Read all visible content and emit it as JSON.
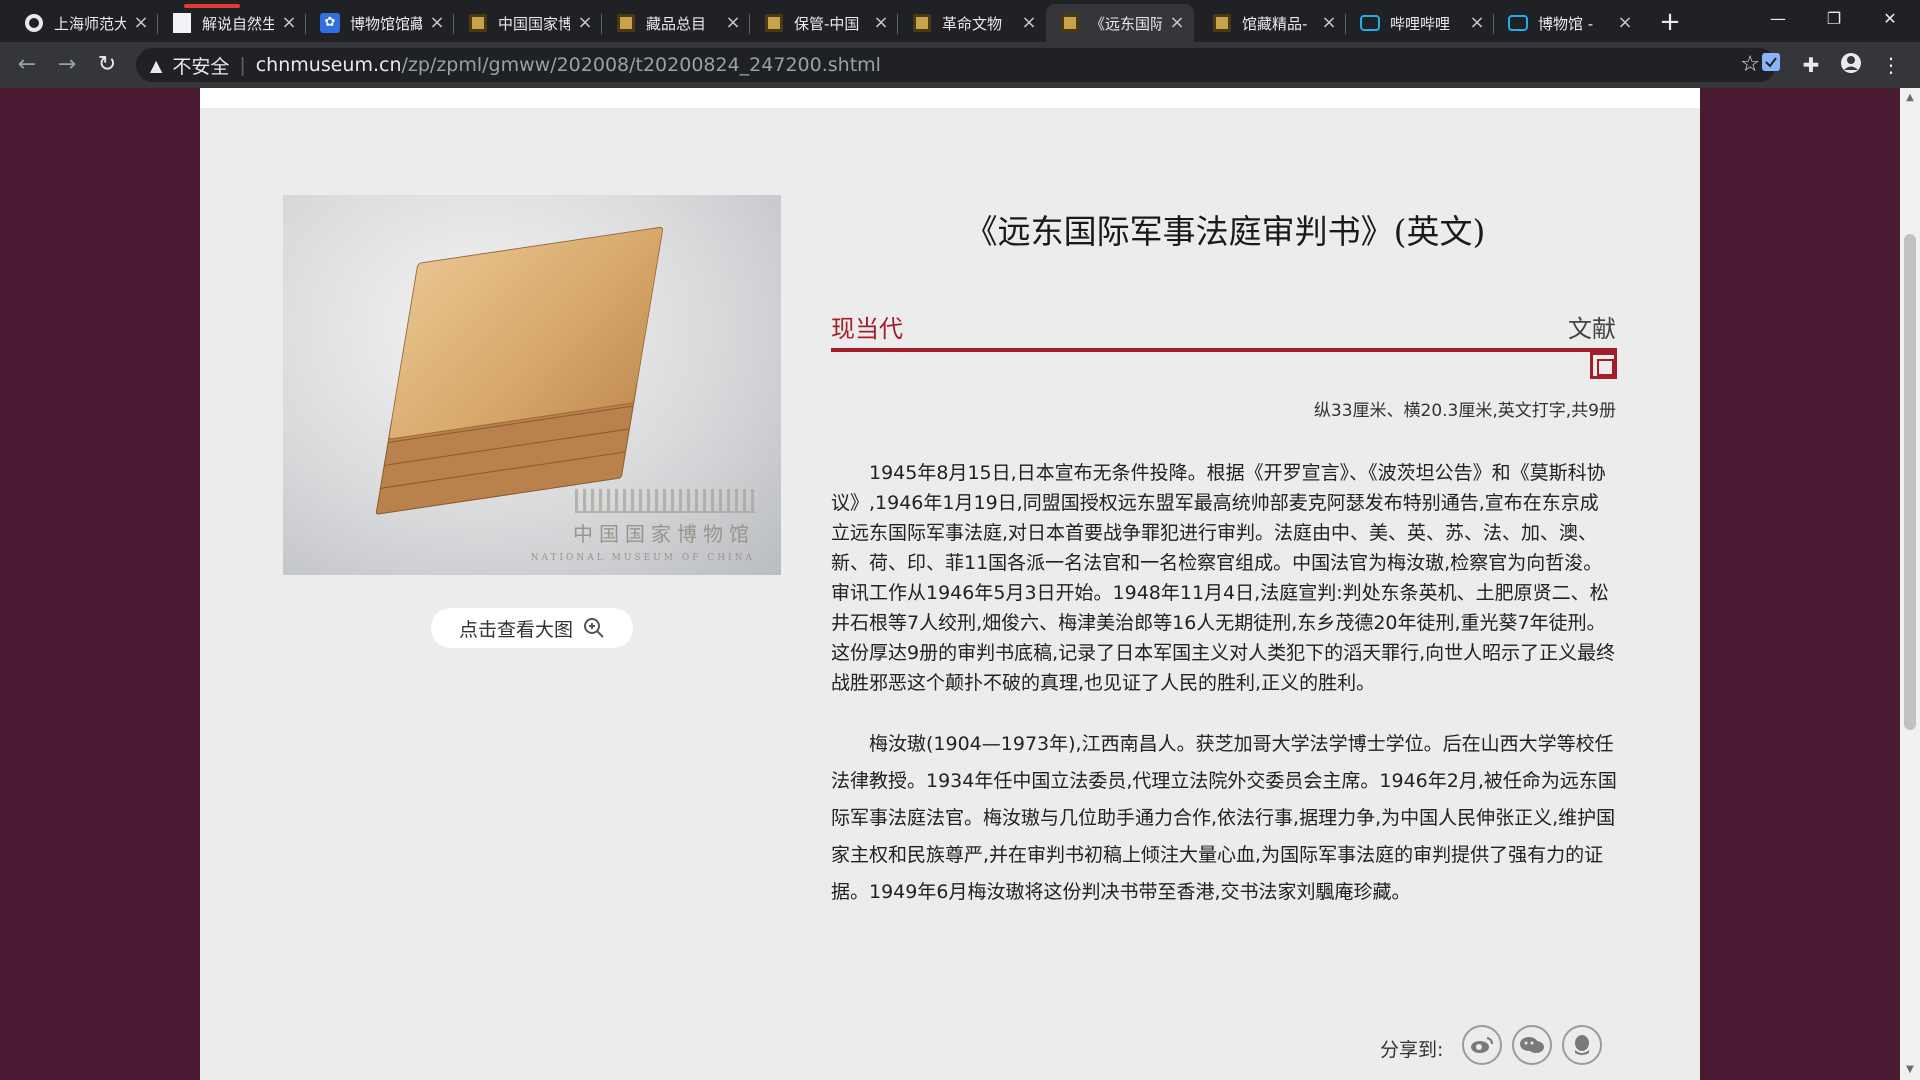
{
  "browser": {
    "tabs": [
      {
        "title": "上海师范大",
        "icon": "globe-icon"
      },
      {
        "title": "解说自然生",
        "icon": "document-icon"
      },
      {
        "title": "博物馆馆藏",
        "icon": "baidu-paw-icon"
      },
      {
        "title": "中国国家博",
        "icon": "museum-icon"
      },
      {
        "title": "藏品总目",
        "icon": "museum-icon"
      },
      {
        "title": "保管-中国",
        "icon": "museum-icon"
      },
      {
        "title": "革命文物",
        "icon": "museum-icon"
      },
      {
        "title": "《远东国际",
        "icon": "museum-icon",
        "active": true
      },
      {
        "title": "馆藏精品-",
        "icon": "museum-icon"
      },
      {
        "title": "哔哩哔哩",
        "icon": "bilibili-icon"
      },
      {
        "title": "博物馆 - ",
        "icon": "bilibili-icon"
      }
    ],
    "new_tab": "+",
    "window": {
      "minimize": "—",
      "maximize": "❐",
      "close": "✕"
    },
    "address": {
      "security_label": "不安全",
      "host": "chnmuseum.cn",
      "path": "/zp/zpml/gmww/202008/t20200824_247200.shtml"
    }
  },
  "artifact": {
    "title": "《远东国际军事法庭审判书》(英文)",
    "era": "现当代",
    "category": "文献",
    "dimensions": "纵33厘米、横20.3厘米,英文打字,共9册",
    "paragraphs": [
      "1945年8月15日,日本宣布无条件投降。根据《开罗宣言》、《波茨坦公告》和《莫斯科协议》,1946年1月19日,同盟国授权远东盟军最高统帅部麦克阿瑟发布特别通告,宣布在东京成立远东国际军事法庭,对日本首要战争罪犯进行审判。法庭由中、美、英、苏、法、加、澳、新、荷、印、菲11国各派一名法官和一名检察官组成。中国法官为梅汝璈,检察官为向哲浚。审讯工作从1946年5月3日开始。1948年11月4日,法庭宣判:判处东条英机、土肥原贤二、松井石根等7人绞刑,畑俊六、梅津美治郎等16人无期徒刑,东乡茂德20年徒刑,重光葵7年徒刑。这份厚达9册的审判书底稿,记录了日本军国主义对人类犯下的滔天罪行,向世人昭示了正义最终战胜邪恶这个颠扑不破的真理,也见证了人民的胜利,正义的胜利。",
      "梅汝璈(1904—1973年),江西南昌人。获芝加哥大学法学博士学位。后在山西大学等校任法律教授。1934年任中国立法委员,代理立法院外交委员会主席。1946年2月,被任命为远东国际军事法庭法官。梅汝璈与几位助手通力合作,依法行事,据理力争,为中国人民伸张正义,维护国家主权和民族尊严,并在审判书初稿上倾注大量心血,为国际军事法庭的审判提供了强有力的证据。1949年6月梅汝璈将这份判决书带至香港,交书法家刘颿庵珍藏。"
    ],
    "view_large_label": "点击查看大图",
    "watermark": {
      "cn": "中国国家博物馆",
      "en": "NATIONAL MUSEUM OF CHINA"
    }
  },
  "share": {
    "label": "分享到:",
    "targets": [
      "weibo-icon",
      "wechat-icon",
      "qq-icon"
    ]
  },
  "colors": {
    "accent": "#a41e2a",
    "page_bg": "#4a1a33",
    "card_bg": "#ececec"
  }
}
